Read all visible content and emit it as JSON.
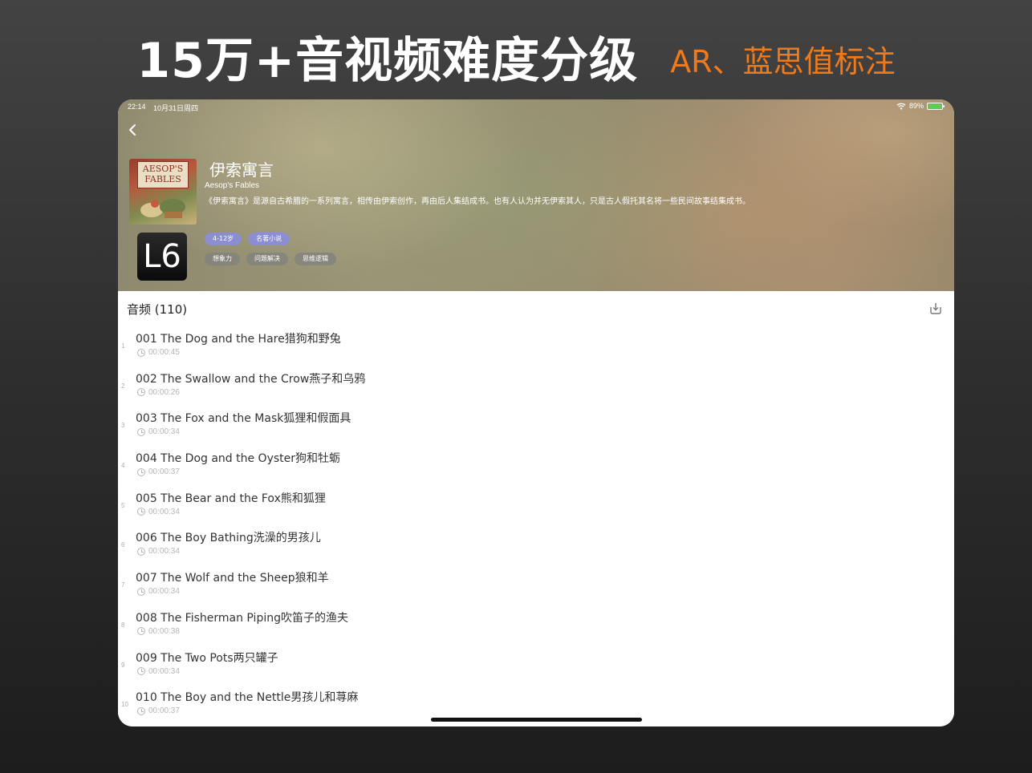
{
  "promo": {
    "title": "15万+音视频难度分级",
    "subtitle": "AR、蓝思值标注"
  },
  "status_bar": {
    "time": "22:14",
    "date": "10月31日周四",
    "battery": "89%"
  },
  "book": {
    "title": "伊索寓言",
    "subtitle": "Aesop's Fables",
    "description": "《伊索寓言》是源自古希腊的一系列寓言，相传由伊索创作，再由后人集结成书。也有人认为并无伊索其人，只是古人假托其名将一些民间故事结集成书。",
    "cover_text_line1": "AESOP'S",
    "cover_text_line2": "FABLES",
    "level": "L6",
    "tags_row1": [
      "4-12岁",
      "名著小说"
    ],
    "tags_row2": [
      "想象力",
      "问题解决",
      "思维逻辑"
    ]
  },
  "audio_section": {
    "header": "音频 (110)"
  },
  "tracks": [
    {
      "index": "1",
      "title": "001 The Dog and the Hare猎狗和野兔",
      "duration": "00:00:45"
    },
    {
      "index": "2",
      "title": "002 The Swallow and the Crow燕子和乌鸦",
      "duration": "00:00:26"
    },
    {
      "index": "3",
      "title": "003 The Fox and the Mask狐狸和假面具",
      "duration": "00:00:34"
    },
    {
      "index": "4",
      "title": "004 The Dog and the Oyster狗和牡蛎",
      "duration": "00:00:37"
    },
    {
      "index": "5",
      "title": "005 The Bear and the Fox熊和狐狸",
      "duration": "00:00:34"
    },
    {
      "index": "6",
      "title": "006 The Boy Bathing洗澡的男孩儿",
      "duration": "00:00:34"
    },
    {
      "index": "7",
      "title": "007 The Wolf and the Sheep狼和羊",
      "duration": "00:00:34"
    },
    {
      "index": "8",
      "title": "008 The Fisherman Piping吹笛子的渔夫",
      "duration": "00:00:38"
    },
    {
      "index": "9",
      "title": "009 The Two Pots两只罐子",
      "duration": "00:00:34"
    },
    {
      "index": "10",
      "title": "010 The Boy and the Nettle男孩儿和荨麻",
      "duration": "00:00:37"
    }
  ],
  "icons": {
    "back": "chevron-left-icon",
    "download": "download-icon",
    "clock": "clock-icon",
    "wifi": "wifi-icon",
    "battery": "battery-icon"
  },
  "colors": {
    "promo_accent": "#f07a1a",
    "tag_purple": "#8b8fcf",
    "battery_green": "#5ccf4f"
  }
}
